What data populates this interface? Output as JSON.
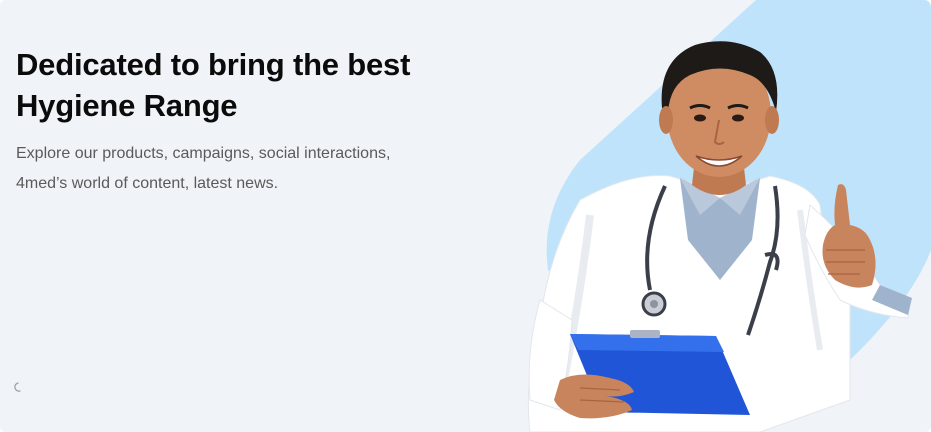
{
  "hero": {
    "title_line1": "Dedicated to bring the best",
    "title_line2": "Hygiene Range",
    "subtitle_line1": "Explore our products, campaigns, social interactions,",
    "subtitle_line2": "4med’s world of content, latest news."
  },
  "colors": {
    "background": "#f0f3f7",
    "accent_shape": "#bfe3fb",
    "title": "#0b0b0b",
    "subtitle": "#5a5a5a",
    "clipboard": "#1f55d6"
  },
  "icons": {
    "loader": "loading-spinner-icon",
    "hero_image": "doctor-thumbs-up-illustration"
  }
}
